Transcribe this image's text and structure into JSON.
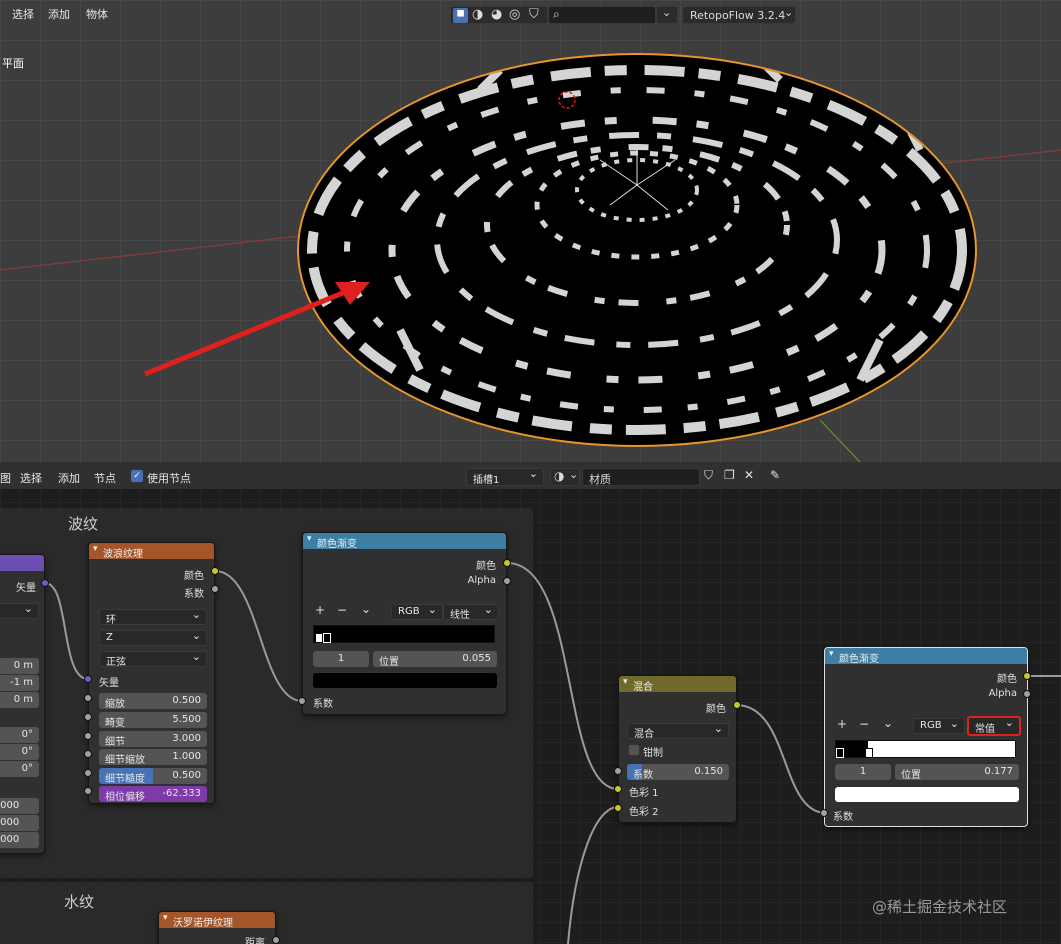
{
  "viewport": {
    "menu": [
      "选择",
      "添加",
      "物体"
    ],
    "object_label": "平面",
    "search_placeholder": "",
    "addon_label": "RetopoFlow 3.2.4"
  },
  "node_header": {
    "menu": [
      "图",
      "选择",
      "添加",
      "节点"
    ],
    "use_nodes_label": "使用节点",
    "slot": "插槽1",
    "material_name": "材质"
  },
  "frames": {
    "wave_frame": "波纹",
    "water_frame": "水纹"
  },
  "left_node": {
    "output": "矢量",
    "values": [
      "0 m",
      "-1 m",
      "0 m",
      "0°",
      "0°",
      "0°",
      ".000",
      ".000",
      ".000"
    ]
  },
  "wave_node": {
    "title": "波浪纹理",
    "out_color": "颜色",
    "out_fac": "系数",
    "type": "环",
    "axis": "Z",
    "profile": "正弦",
    "vector": "矢量",
    "params": [
      {
        "label": "缩放",
        "value": "0.500"
      },
      {
        "label": "畸变",
        "value": "5.500"
      },
      {
        "label": "细节",
        "value": "3.000"
      },
      {
        "label": "细节缩放",
        "value": "1.000"
      },
      {
        "label": "细节糙度",
        "value": "0.500"
      },
      {
        "label": "相位偏移",
        "value": "-62.333"
      }
    ]
  },
  "ramp1": {
    "title": "颜色渐变",
    "out_color": "颜色",
    "out_alpha": "Alpha",
    "mode": "RGB",
    "interp": "线性",
    "index": "1",
    "pos_label": "位置",
    "pos_value": "0.055",
    "in_fac": "系数"
  },
  "mix": {
    "title": "混合",
    "out_color": "颜色",
    "blend": "混合",
    "clamp": "钳制",
    "fac_label": "系数",
    "fac_value": "0.150",
    "color1": "色彩 1",
    "color2": "色彩 2"
  },
  "ramp2": {
    "title": "颜色渐变",
    "out_color": "颜色",
    "out_alpha": "Alpha",
    "mode": "RGB",
    "interp": "常值",
    "index": "1",
    "pos_label": "位置",
    "pos_value": "0.177",
    "in_fac": "系数"
  },
  "voronoi": {
    "title": "沃罗诺伊纹理",
    "out_dist": "距离"
  },
  "watermark": "@稀土掘金技术社区",
  "colors": {
    "accent_red": "#e0201e",
    "edge_orange": "#e8952f"
  }
}
